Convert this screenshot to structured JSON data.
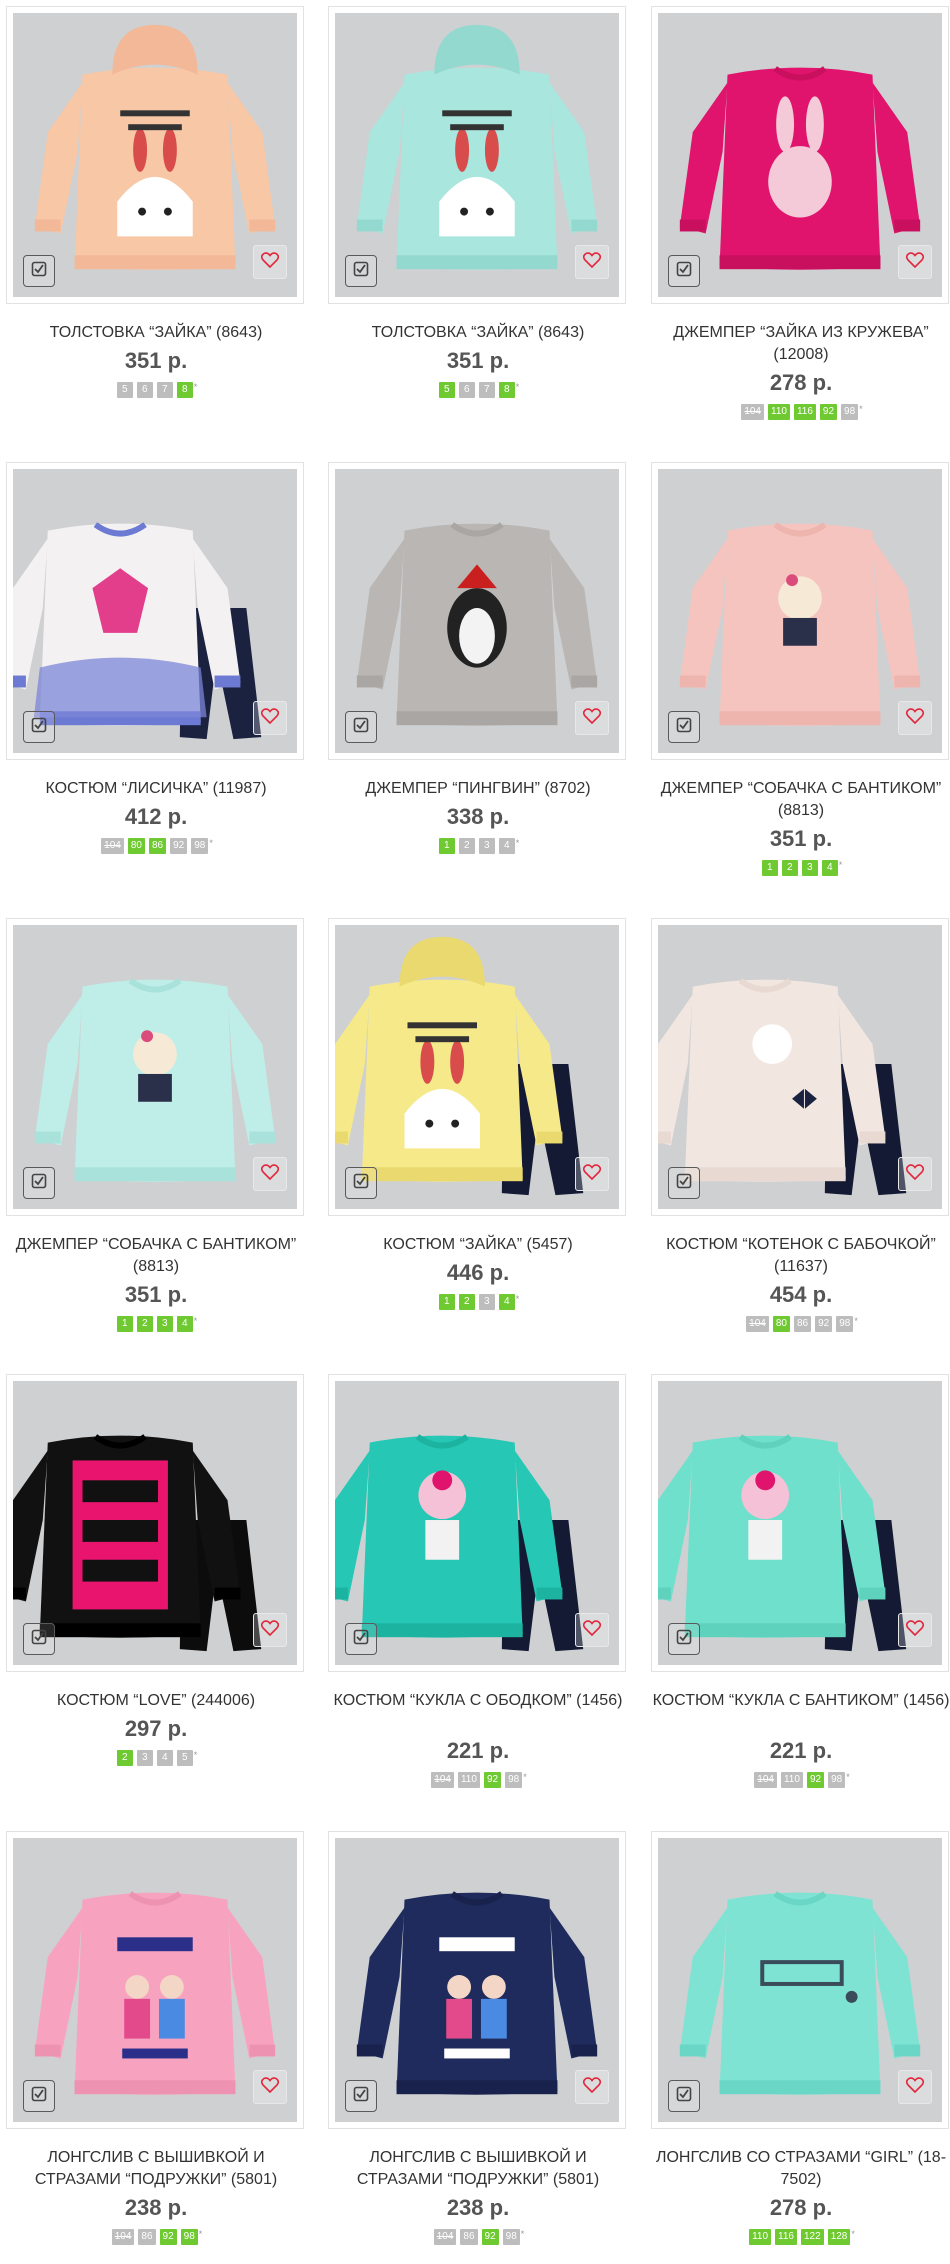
{
  "colors": {
    "accent_green": "#6fc930",
    "size_gray": "#bdbdbd",
    "price_gray": "#555555",
    "favorite_red": "#e2263b"
  },
  "icons": {
    "compare": "checkbox-icon",
    "favorite": "heart-icon"
  },
  "products": [
    {
      "name": "ТОЛСТОВКА “ЗАЙКА” (8643)",
      "price": "351 р.",
      "image": "peach-hoodie-bunny",
      "sizes": [
        {
          "label": "5",
          "available": false
        },
        {
          "label": "6",
          "available": false
        },
        {
          "label": "7",
          "available": false
        },
        {
          "label": "8",
          "available": true
        }
      ]
    },
    {
      "name": "ТОЛСТОВКА “ЗАЙКА” (8643)",
      "price": "351 р.",
      "image": "mint-hoodie-bunny",
      "sizes": [
        {
          "label": "5",
          "available": true
        },
        {
          "label": "6",
          "available": false
        },
        {
          "label": "7",
          "available": false
        },
        {
          "label": "8",
          "available": true
        }
      ]
    },
    {
      "name": "ДЖЕМПЕР “ЗАЙКА ИЗ КРУЖЕВА” (12008)",
      "price": "278 р.",
      "image": "magenta-sweater-lace-bunny",
      "sizes": [
        {
          "label": "104",
          "available": false,
          "struck": true
        },
        {
          "label": "110",
          "available": true
        },
        {
          "label": "116",
          "available": true
        },
        {
          "label": "92",
          "available": true
        },
        {
          "label": "98",
          "available": false
        }
      ]
    },
    {
      "name": "КОСТЮМ “ЛИСИЧКА” (11987)",
      "price": "412 р.",
      "image": "fox-top-leggings",
      "sizes": [
        {
          "label": "104",
          "available": false,
          "struck": true
        },
        {
          "label": "80",
          "available": true
        },
        {
          "label": "86",
          "available": true
        },
        {
          "label": "92",
          "available": false
        },
        {
          "label": "98",
          "available": false
        }
      ]
    },
    {
      "name": "ДЖЕМПЕР “ПИНГВИН” (8702)",
      "price": "338 р.",
      "image": "grey-sweater-penguin",
      "sizes": [
        {
          "label": "1",
          "available": true
        },
        {
          "label": "2",
          "available": false
        },
        {
          "label": "3",
          "available": false
        },
        {
          "label": "4",
          "available": false
        }
      ]
    },
    {
      "name": "ДЖЕМПЕР “СОБАЧКА С БАНТИКОМ” (8813)",
      "price": "351 р.",
      "image": "pink-sweater-dog",
      "sizes": [
        {
          "label": "1",
          "available": true
        },
        {
          "label": "2",
          "available": true
        },
        {
          "label": "3",
          "available": true
        },
        {
          "label": "4",
          "available": true
        }
      ]
    },
    {
      "name": "ДЖЕМПЕР “СОБАЧКА С БАНТИКОМ” (8813)",
      "price": "351 р.",
      "image": "mint-sweater-dog",
      "sizes": [
        {
          "label": "1",
          "available": true
        },
        {
          "label": "2",
          "available": true
        },
        {
          "label": "3",
          "available": true
        },
        {
          "label": "4",
          "available": true
        }
      ]
    },
    {
      "name": "КОСТЮМ “ЗАЙКА” (5457)",
      "price": "446 р.",
      "image": "yellow-hoodie-leggings",
      "sizes": [
        {
          "label": "1",
          "available": true
        },
        {
          "label": "2",
          "available": true
        },
        {
          "label": "3",
          "available": false
        },
        {
          "label": "4",
          "available": true
        }
      ]
    },
    {
      "name": "КОСТЮМ “КОТЕНОК С БАБОЧКОЙ” (11637)",
      "price": "454 р.",
      "image": "cream-top-kitten",
      "sizes": [
        {
          "label": "104",
          "available": false,
          "struck": true
        },
        {
          "label": "80",
          "available": true
        },
        {
          "label": "86",
          "available": false
        },
        {
          "label": "92",
          "available": false
        },
        {
          "label": "98",
          "available": false
        }
      ]
    },
    {
      "name": "КОСТЮМ “LOVE” (244006)",
      "price": "297 р.",
      "image": "black-love-set",
      "sizes": [
        {
          "label": "2",
          "available": true
        },
        {
          "label": "3",
          "available": false
        },
        {
          "label": "4",
          "available": false
        },
        {
          "label": "5",
          "available": false
        }
      ]
    },
    {
      "name": "КОСТЮМ “КУКЛА С ОБОДКОМ” (1456)",
      "price": "221 р.",
      "image": "teal-doll-set",
      "sizes": [
        {
          "label": "104",
          "available": false,
          "struck": true
        },
        {
          "label": "110",
          "available": false
        },
        {
          "label": "92",
          "available": true
        },
        {
          "label": "98",
          "available": false
        }
      ]
    },
    {
      "name": "КОСТЮМ “КУКЛА С БАНТИКОМ” (1456)",
      "price": "221 р.",
      "image": "mint-doll-set",
      "sizes": [
        {
          "label": "104",
          "available": false,
          "struck": true
        },
        {
          "label": "110",
          "available": false
        },
        {
          "label": "92",
          "available": true
        },
        {
          "label": "98",
          "available": false
        }
      ]
    },
    {
      "name": "ЛОНГСЛИВ С ВЫШИВКОЙ И СТРАЗАМИ “ПОДРУЖКИ” (5801)",
      "price": "238 р.",
      "image": "pink-longsleeve-girls",
      "sizes": [
        {
          "label": "104",
          "available": false,
          "struck": true
        },
        {
          "label": "86",
          "available": false
        },
        {
          "label": "92",
          "available": true
        },
        {
          "label": "98",
          "available": true
        }
      ]
    },
    {
      "name": "ЛОНГСЛИВ С ВЫШИВКОЙ И СТРАЗАМИ “ПОДРУЖКИ” (5801)",
      "price": "238 р.",
      "image": "navy-longsleeve-girls",
      "sizes": [
        {
          "label": "104",
          "available": false,
          "struck": true
        },
        {
          "label": "86",
          "available": false
        },
        {
          "label": "92",
          "available": true
        },
        {
          "label": "98",
          "available": false
        }
      ]
    },
    {
      "name": "ЛОНГСЛИВ СО СТРАЗАМИ “GIRL” (18-7502)",
      "price": "278 р.",
      "image": "mint-longsleeve-girl",
      "sizes": [
        {
          "label": "110",
          "available": true
        },
        {
          "label": "116",
          "available": true
        },
        {
          "label": "122",
          "available": true
        },
        {
          "label": "128",
          "available": true
        }
      ]
    }
  ]
}
